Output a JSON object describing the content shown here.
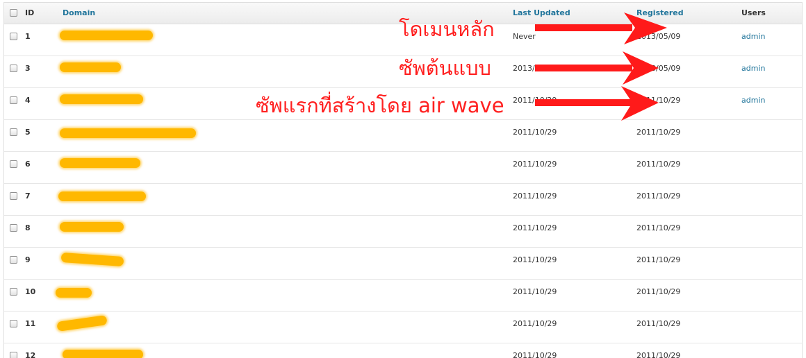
{
  "header": {
    "id": "ID",
    "domain": "Domain",
    "last_updated": "Last Updated",
    "registered": "Registered",
    "users": "Users"
  },
  "rows": [
    {
      "id": "1",
      "last_updated": "Never",
      "registered": "2013/05/09",
      "users": "admin"
    },
    {
      "id": "3",
      "last_updated": "2013/05/09",
      "registered": "2013/05/09",
      "users": "admin"
    },
    {
      "id": "4",
      "last_updated": "2011/10/29",
      "registered": "2011/10/29",
      "users": "admin"
    },
    {
      "id": "5",
      "last_updated": "2011/10/29",
      "registered": "2011/10/29",
      "users": ""
    },
    {
      "id": "6",
      "last_updated": "2011/10/29",
      "registered": "2011/10/29",
      "users": ""
    },
    {
      "id": "7",
      "last_updated": "2011/10/29",
      "registered": "2011/10/29",
      "users": ""
    },
    {
      "id": "8",
      "last_updated": "2011/10/29",
      "registered": "2011/10/29",
      "users": ""
    },
    {
      "id": "9",
      "last_updated": "2011/10/29",
      "registered": "2011/10/29",
      "users": ""
    },
    {
      "id": "10",
      "last_updated": "2011/10/29",
      "registered": "2011/10/29",
      "users": ""
    },
    {
      "id": "11",
      "last_updated": "2011/10/29",
      "registered": "2011/10/29",
      "users": ""
    },
    {
      "id": "12",
      "last_updated": "2011/10/29",
      "registered": "2011/10/29",
      "users": ""
    }
  ],
  "annotations": {
    "main_domain": "โดเมนหลัก",
    "template_sub": "ซัพต้นแบบ",
    "first_sub": "ซัพแรกที่สร้างโดย air wave"
  },
  "colors": {
    "annotation": "#ff2020",
    "redaction": "#ffb800",
    "link": "#21759b"
  }
}
